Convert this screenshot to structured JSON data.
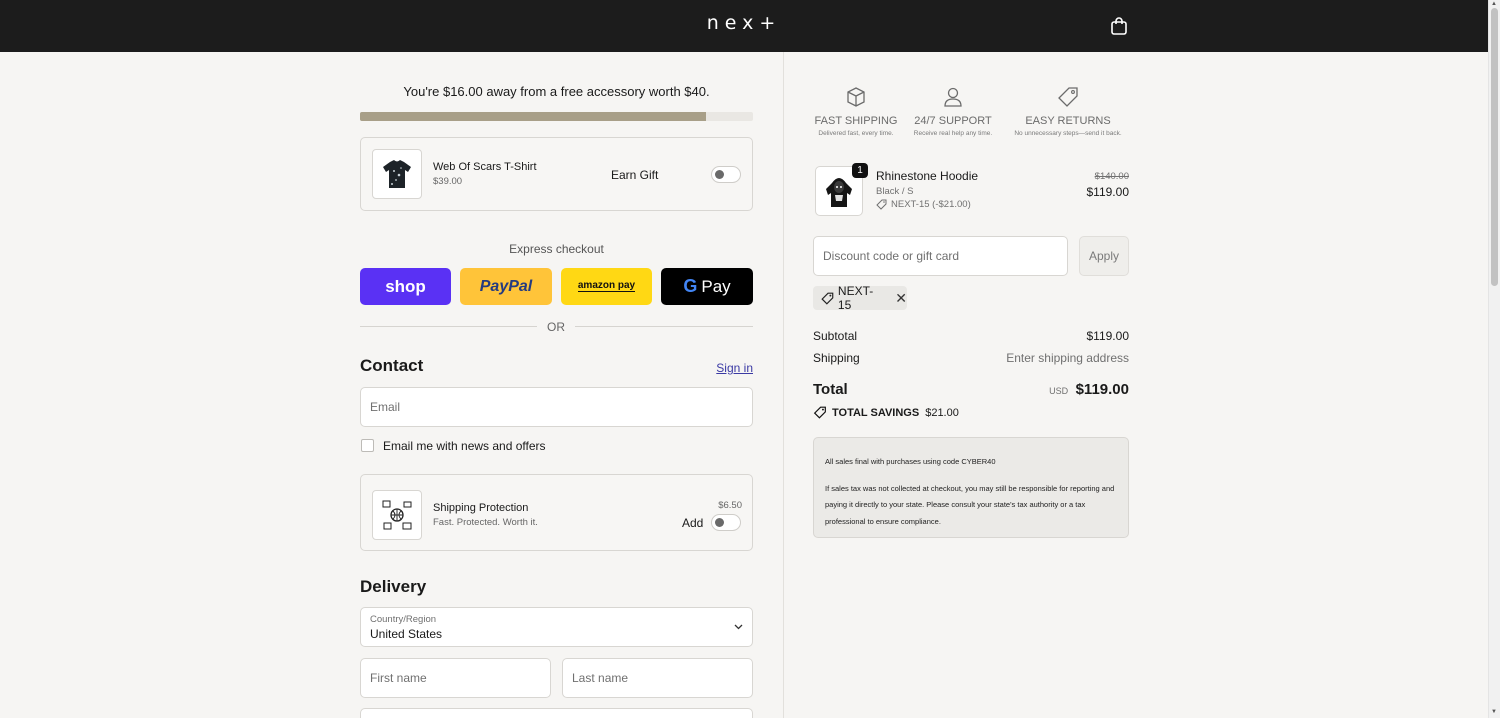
{
  "header": {
    "logo": "nex+"
  },
  "promo": {
    "text": "You're $16.00 away from a free accessory worth $40.",
    "progress_percent": 88
  },
  "gift_item": {
    "name": "Web Of Scars T-Shirt",
    "price": "$39.00",
    "action_label": "Earn Gift",
    "toggle_on": false
  },
  "express": {
    "label": "Express checkout",
    "buttons": [
      {
        "label": "shop",
        "color": "#5a31f4"
      },
      {
        "label": "PayPal",
        "color": "#ffc439"
      },
      {
        "label": "amazon pay",
        "color": "#ffd814"
      },
      {
        "label": "Pay",
        "color": "#000000"
      }
    ],
    "or_text": "OR"
  },
  "contact": {
    "title": "Contact",
    "signin_label": "Sign in",
    "email_placeholder": "Email",
    "newsletter_label": "Email me with news and offers"
  },
  "shipping_protection": {
    "name": "Shipping Protection",
    "tagline": "Fast. Protected. Worth it.",
    "price": "$6.50",
    "add_label": "Add",
    "toggle_on": false
  },
  "delivery": {
    "title": "Delivery",
    "country_label": "Country/Region",
    "country_value": "United States",
    "first_name_placeholder": "First name",
    "last_name_placeholder": "Last name"
  },
  "features": [
    {
      "icon": "box-icon",
      "title": "FAST SHIPPING",
      "subtitle": "Delivered fast, every time."
    },
    {
      "icon": "person-icon",
      "title": "24/7 SUPPORT",
      "subtitle": "Receive real help any time."
    },
    {
      "icon": "tag-icon",
      "title": "EASY RETURNS",
      "subtitle": "No unnecessary steps—send it back."
    }
  ],
  "order_item": {
    "quantity": "1",
    "name": "Rhinestone Hoodie",
    "variant": "Black / S",
    "discount": "NEXT-15 (-$21.00)",
    "original_price": "$140.00",
    "price": "$119.00"
  },
  "discount": {
    "placeholder": "Discount code or gift card",
    "apply_label": "Apply",
    "applied_code": "NEXT-15"
  },
  "summary": {
    "subtotal_label": "Subtotal",
    "subtotal_value": "$119.00",
    "shipping_label": "Shipping",
    "shipping_value": "Enter shipping address",
    "total_label": "Total",
    "currency": "USD",
    "total_value": "$119.00",
    "savings_label": "TOTAL SAVINGS",
    "savings_value": "$21.00"
  },
  "notice": {
    "line1": "All sales final with purchases using code CYBER40",
    "line2": "If sales tax was not collected at checkout, you may still be responsible for reporting and paying it directly to your state. Please consult your state's tax authority or a tax professional to ensure compliance."
  }
}
